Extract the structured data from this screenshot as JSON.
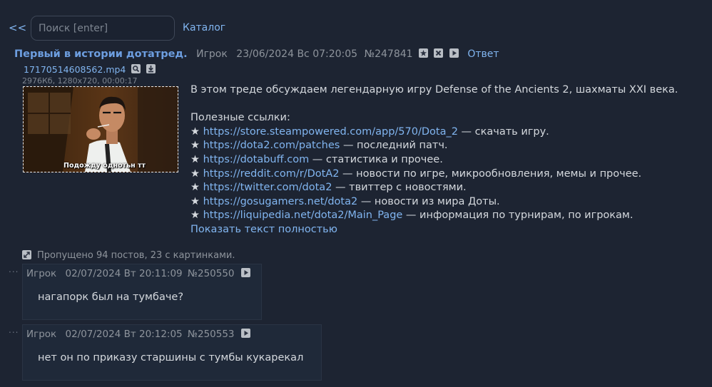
{
  "nav": {
    "back_label": "<<",
    "search_placeholder": "Поиск [enter]",
    "catalog_label": "Каталог"
  },
  "op": {
    "title": "Первый в истории дотатред.",
    "poster": "Игрок",
    "datetime": "23/06/2024 Вс 07:20:05",
    "number": "№247841",
    "reply_label": "Ответ",
    "file": {
      "name": "17170514608562.mp4",
      "info": "2976Кб, 1280x720, 00:00:17",
      "caption": "Подожду однотьн тт"
    },
    "intro": "В этом треде обсуждаем легендарную игру Defense of the Ancients 2, шахматы XXI века.",
    "links_heading": "Полезные ссылки:",
    "links": [
      {
        "url": "https://store.steampowered.com/app/570/Dota_2",
        "desc": " — скачать игру."
      },
      {
        "url": "https://dota2.com/patches",
        "desc": " — последний патч."
      },
      {
        "url": "https://dotabuff.com",
        "desc": " — статистика и прочее."
      },
      {
        "url": "https://reddit.com/r/DotA2",
        "desc": " — новости по игре, микрообновления, мемы и прочее."
      },
      {
        "url": "https://twitter.com/dota2",
        "desc": " — твиттер с новостями."
      },
      {
        "url": "https://gosugamers.net/dota2",
        "desc": " — новости из мира Доты."
      },
      {
        "url": "https://liquipedia.net/dota2/Main_Page",
        "desc": " — информация по турнирам, по игрокам."
      }
    ],
    "bullet": "★",
    "show_full_label": "Показать текст полностью"
  },
  "omitted": {
    "text": "Пропущено 94 постов, 23 с картинками."
  },
  "replies": [
    {
      "dots": "...",
      "poster": "Игрок",
      "datetime": "02/07/2024 Вт 20:11:09",
      "number": "№250550",
      "text": "нагапорк был на тумбаче?"
    },
    {
      "dots": "...",
      "poster": "Игрок",
      "datetime": "02/07/2024 Вт 20:12:05",
      "number": "№250553",
      "text": "нет он по приказу старшины с тумбы кукарекал"
    }
  ],
  "colors": {
    "background": "#1d2432",
    "link": "#81b5f0",
    "title": "#6d9ee0",
    "meta": "#8e949c",
    "text": "#d4d8dd",
    "post_bg": "#1f2939"
  },
  "icons": {
    "star_button": "star-icon",
    "hide_button": "close-icon",
    "play_button": "play-icon",
    "search_file": "magnify-icon",
    "download_file": "download-icon",
    "expand": "expand-icon"
  }
}
